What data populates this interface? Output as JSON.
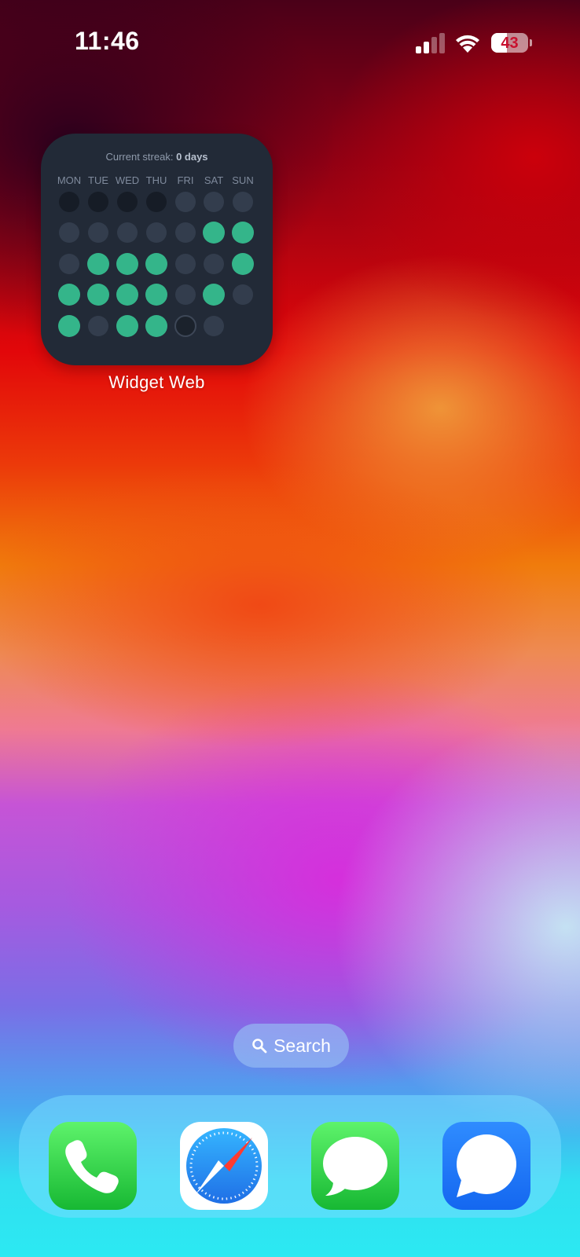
{
  "status_bar": {
    "time": "11:46",
    "battery_percent": 43,
    "battery_label": "43",
    "signal_bars_active": 2,
    "signal_bars_total": 4,
    "icons": [
      "cellular-signal-icon",
      "wifi-icon",
      "battery-icon"
    ]
  },
  "widget": {
    "streak_label": "Current streak:",
    "streak_value": "0 days",
    "days": [
      "MON",
      "TUE",
      "WED",
      "THU",
      "FRI",
      "SAT",
      "SUN"
    ],
    "grid": [
      [
        "dark",
        "dark",
        "dark",
        "dark",
        "gray",
        "gray",
        "gray"
      ],
      [
        "gray",
        "gray",
        "gray",
        "gray",
        "gray",
        "green",
        "green"
      ],
      [
        "gray",
        "green",
        "green",
        "green",
        "gray",
        "gray",
        "green"
      ],
      [
        "green",
        "green",
        "green",
        "green",
        "gray",
        "green",
        "gray"
      ],
      [
        "green",
        "gray",
        "green",
        "green",
        "today",
        "gray",
        "none"
      ]
    ],
    "colors": {
      "background": "#222a37",
      "done": "#34b58a",
      "missed": "#333d4d",
      "outside": "#161c26"
    },
    "caption": "Widget Web"
  },
  "search": {
    "label": "Search",
    "icon": "magnifier-icon"
  },
  "dock": {
    "apps": [
      {
        "name": "Phone",
        "icon": "phone-icon"
      },
      {
        "name": "Safari",
        "icon": "safari-compass-icon"
      },
      {
        "name": "Messages",
        "icon": "messages-icon"
      },
      {
        "name": "Signal",
        "icon": "chat-bubble-icon"
      }
    ]
  }
}
